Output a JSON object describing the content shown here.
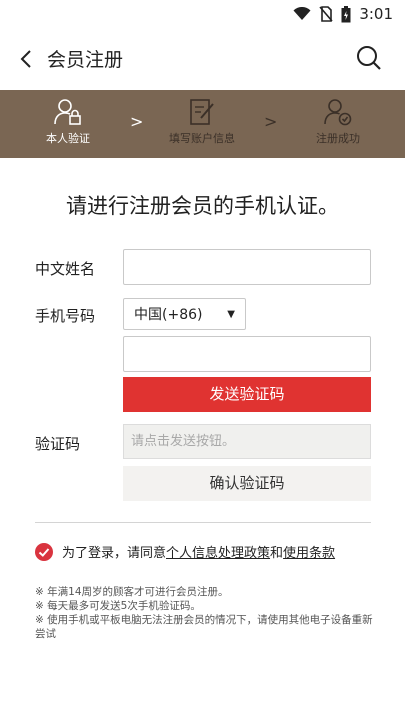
{
  "status": {
    "time": "3:01"
  },
  "header": {
    "title": "会员注册"
  },
  "steps": [
    {
      "label": "本人验证"
    },
    {
      "label": "填写账户信息"
    },
    {
      "label": "注册成功"
    }
  ],
  "step_separator": ">",
  "headline": "请进行注册会员的手机认证。",
  "form": {
    "name_label": "中文姓名",
    "phone_label": "手机号码",
    "country_code": "中国(+86)",
    "country_caret": "▼",
    "send_button": "发送验证码",
    "code_label": "验证码",
    "code_placeholder": "请点击发送按钮。",
    "confirm_button": "确认验证码"
  },
  "agreement": {
    "prefix": "为了登录，请同意",
    "privacy_link": "个人信息处理政策",
    "and": "和",
    "terms_link": "使用条款"
  },
  "notes": [
    "※ 年满14周岁的顾客才可进行会员注册。",
    "※ 每天最多可发送5次手机验证码。",
    "※ 使用手机或平板电脑无法注册会员的情况下，请使用其他电子设备重新尝试"
  ],
  "colors": {
    "step_bar": "#7a6653",
    "primary_red": "#e03331"
  }
}
